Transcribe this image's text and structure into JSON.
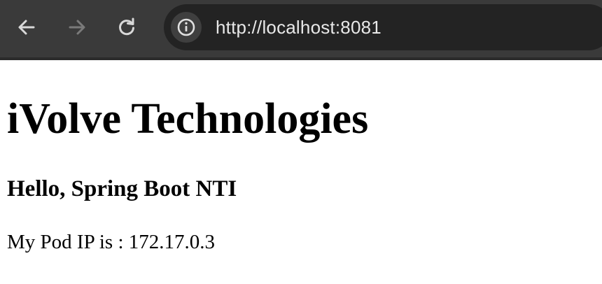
{
  "browser": {
    "url": "http://localhost:8081",
    "icons": {
      "back": "arrow-left-icon",
      "forward": "arrow-right-icon",
      "reload": "reload-icon",
      "site_info": "info-icon"
    },
    "colors": {
      "toolbar": "#3a3a3a",
      "omnibox": "#232323",
      "icon_active": "#d8d8d8",
      "icon_disabled": "#7a7a7a"
    }
  },
  "page": {
    "title": "iVolve Technologies",
    "greeting": "Hello, Spring Boot NTI",
    "pod_ip_line": "My Pod IP is : 172.17.0.3"
  }
}
